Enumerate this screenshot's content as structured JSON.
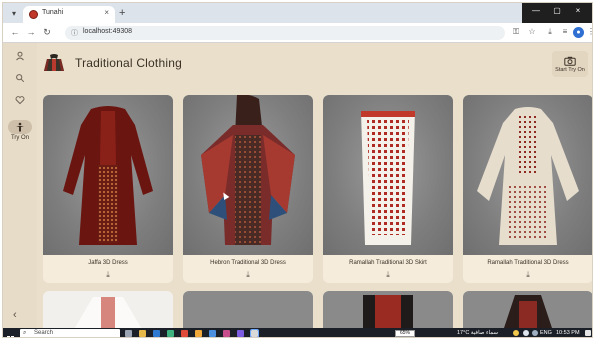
{
  "browser": {
    "tab_title": "Tunahi",
    "url": "localhost:49308",
    "tab_close": "×",
    "new_tab": "+",
    "window_controls": [
      "—",
      "▢",
      "×"
    ]
  },
  "app": {
    "title": "Traditional Clothing",
    "start_try_on_label": "Start Try On",
    "rail": {
      "items": [
        {
          "icon": "user-icon",
          "label": ""
        },
        {
          "icon": "search-icon",
          "label": ""
        },
        {
          "icon": "heart-icon",
          "label": ""
        },
        {
          "icon": "try-on-icon",
          "label": "Try On",
          "active": true
        }
      ],
      "collapse_glyph": "‹"
    },
    "cards": [
      {
        "title": "Jaffa 3D Dress",
        "download_icon": "download-icon"
      },
      {
        "title": "Hebron Traditional 3D Dress",
        "download_icon": "download-icon"
      },
      {
        "title": "Ramallah Traditional 3D Skirt",
        "download_icon": "download-icon"
      },
      {
        "title": "Ramallah Traditional 3D Dress",
        "download_icon": "download-icon"
      }
    ]
  },
  "taskbar": {
    "search_placeholder": "Search",
    "battery": "65%",
    "weather": "17°C  سماء صافية",
    "lang": "ENG",
    "time": "10:53 PM"
  }
}
